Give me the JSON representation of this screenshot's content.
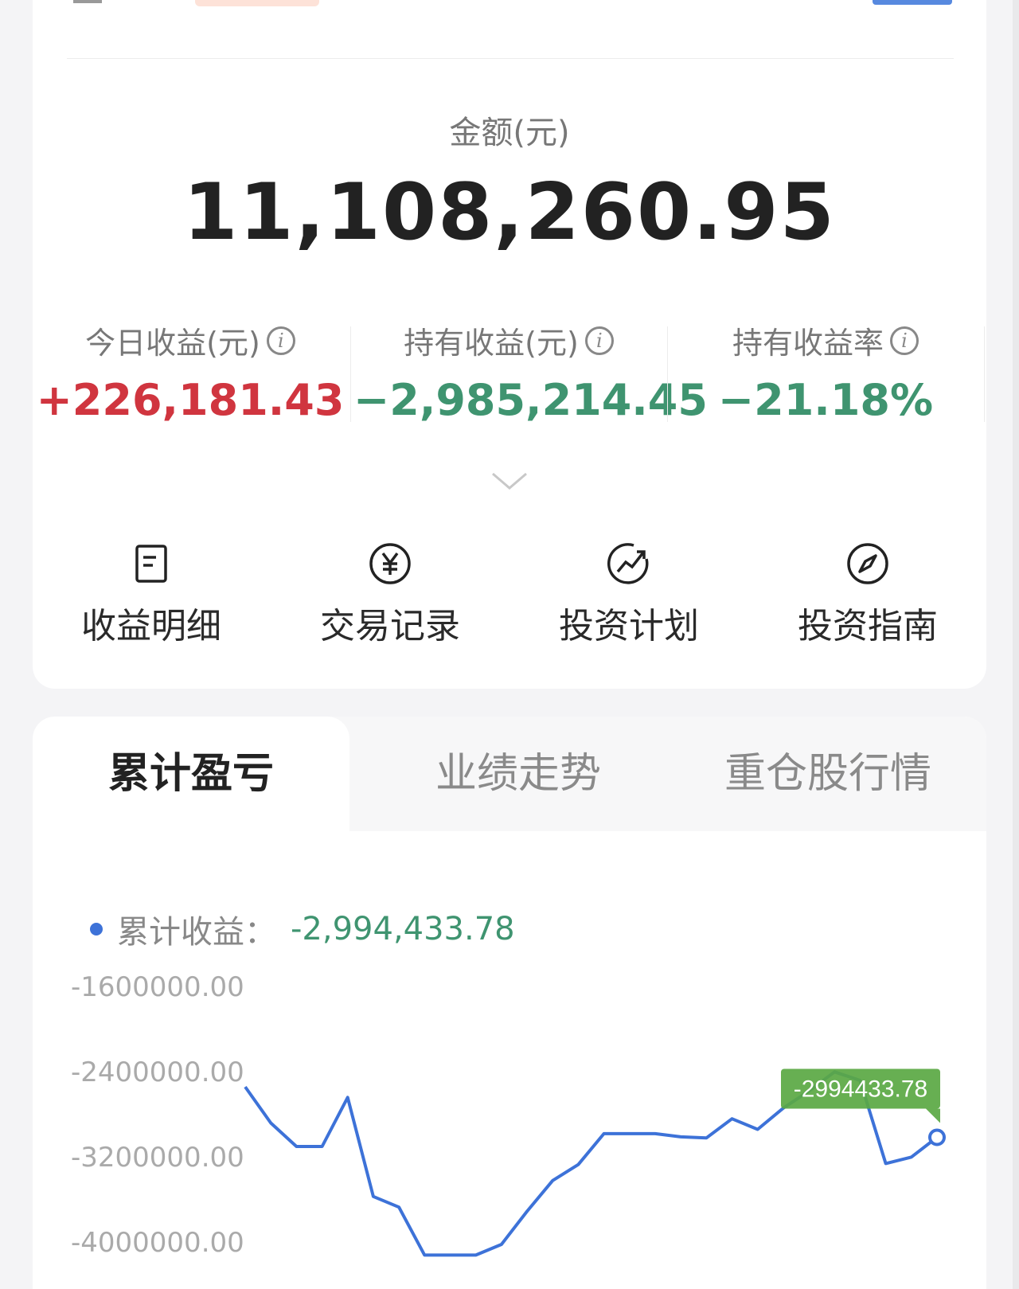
{
  "summary": {
    "amount_label": "金额(元)",
    "amount_value": "11,108,260.95",
    "stats": [
      {
        "label": "今日收益(元)",
        "value": "+226,181.43",
        "tone": "red"
      },
      {
        "label": "持有收益(元)",
        "value": "−2,985,214.45",
        "tone": "green"
      },
      {
        "label": "持有收益率",
        "value": "−21.18%",
        "tone": "green"
      }
    ]
  },
  "actions": [
    {
      "label": "收益明细",
      "icon": "document-icon"
    },
    {
      "label": "交易记录",
      "icon": "yuan-icon"
    },
    {
      "label": "投资计划",
      "icon": "trend-icon"
    },
    {
      "label": "投资指南",
      "icon": "compass-icon"
    }
  ],
  "tabs": [
    {
      "label": "累计盈亏",
      "active": true
    },
    {
      "label": "业绩走势",
      "active": false
    },
    {
      "label": "重仓股行情",
      "active": false
    }
  ],
  "legend": {
    "label": "累计收益：",
    "value": "-2,994,433.78"
  },
  "colors": {
    "up": "#d0353f",
    "down": "#3f9470",
    "line": "#3d72d8",
    "tooltip": "#5aa843"
  },
  "chart_data": {
    "type": "line",
    "y_ticks": [
      "-1600000.00",
      "-2400000.00",
      "-3200000.00",
      "-4000000.00"
    ],
    "ylim": [
      -4200000,
      -1600000
    ],
    "series": [
      {
        "values": [
          -2520000,
          -2860000,
          -3080000,
          -3080000,
          -2620000,
          -3550000,
          -3650000,
          -4100000,
          -4100000,
          -4100000,
          -4000000,
          -3690000,
          -3400000,
          -3250000,
          -2960000,
          -2960000,
          -2960000,
          -2990000,
          -3000000,
          -2820000,
          -2920000,
          -2720000,
          -2560000,
          -2380000,
          -2460000,
          -3240000,
          -3180000,
          -2994433.78
        ]
      }
    ],
    "tooltip": "-2994433.78"
  }
}
